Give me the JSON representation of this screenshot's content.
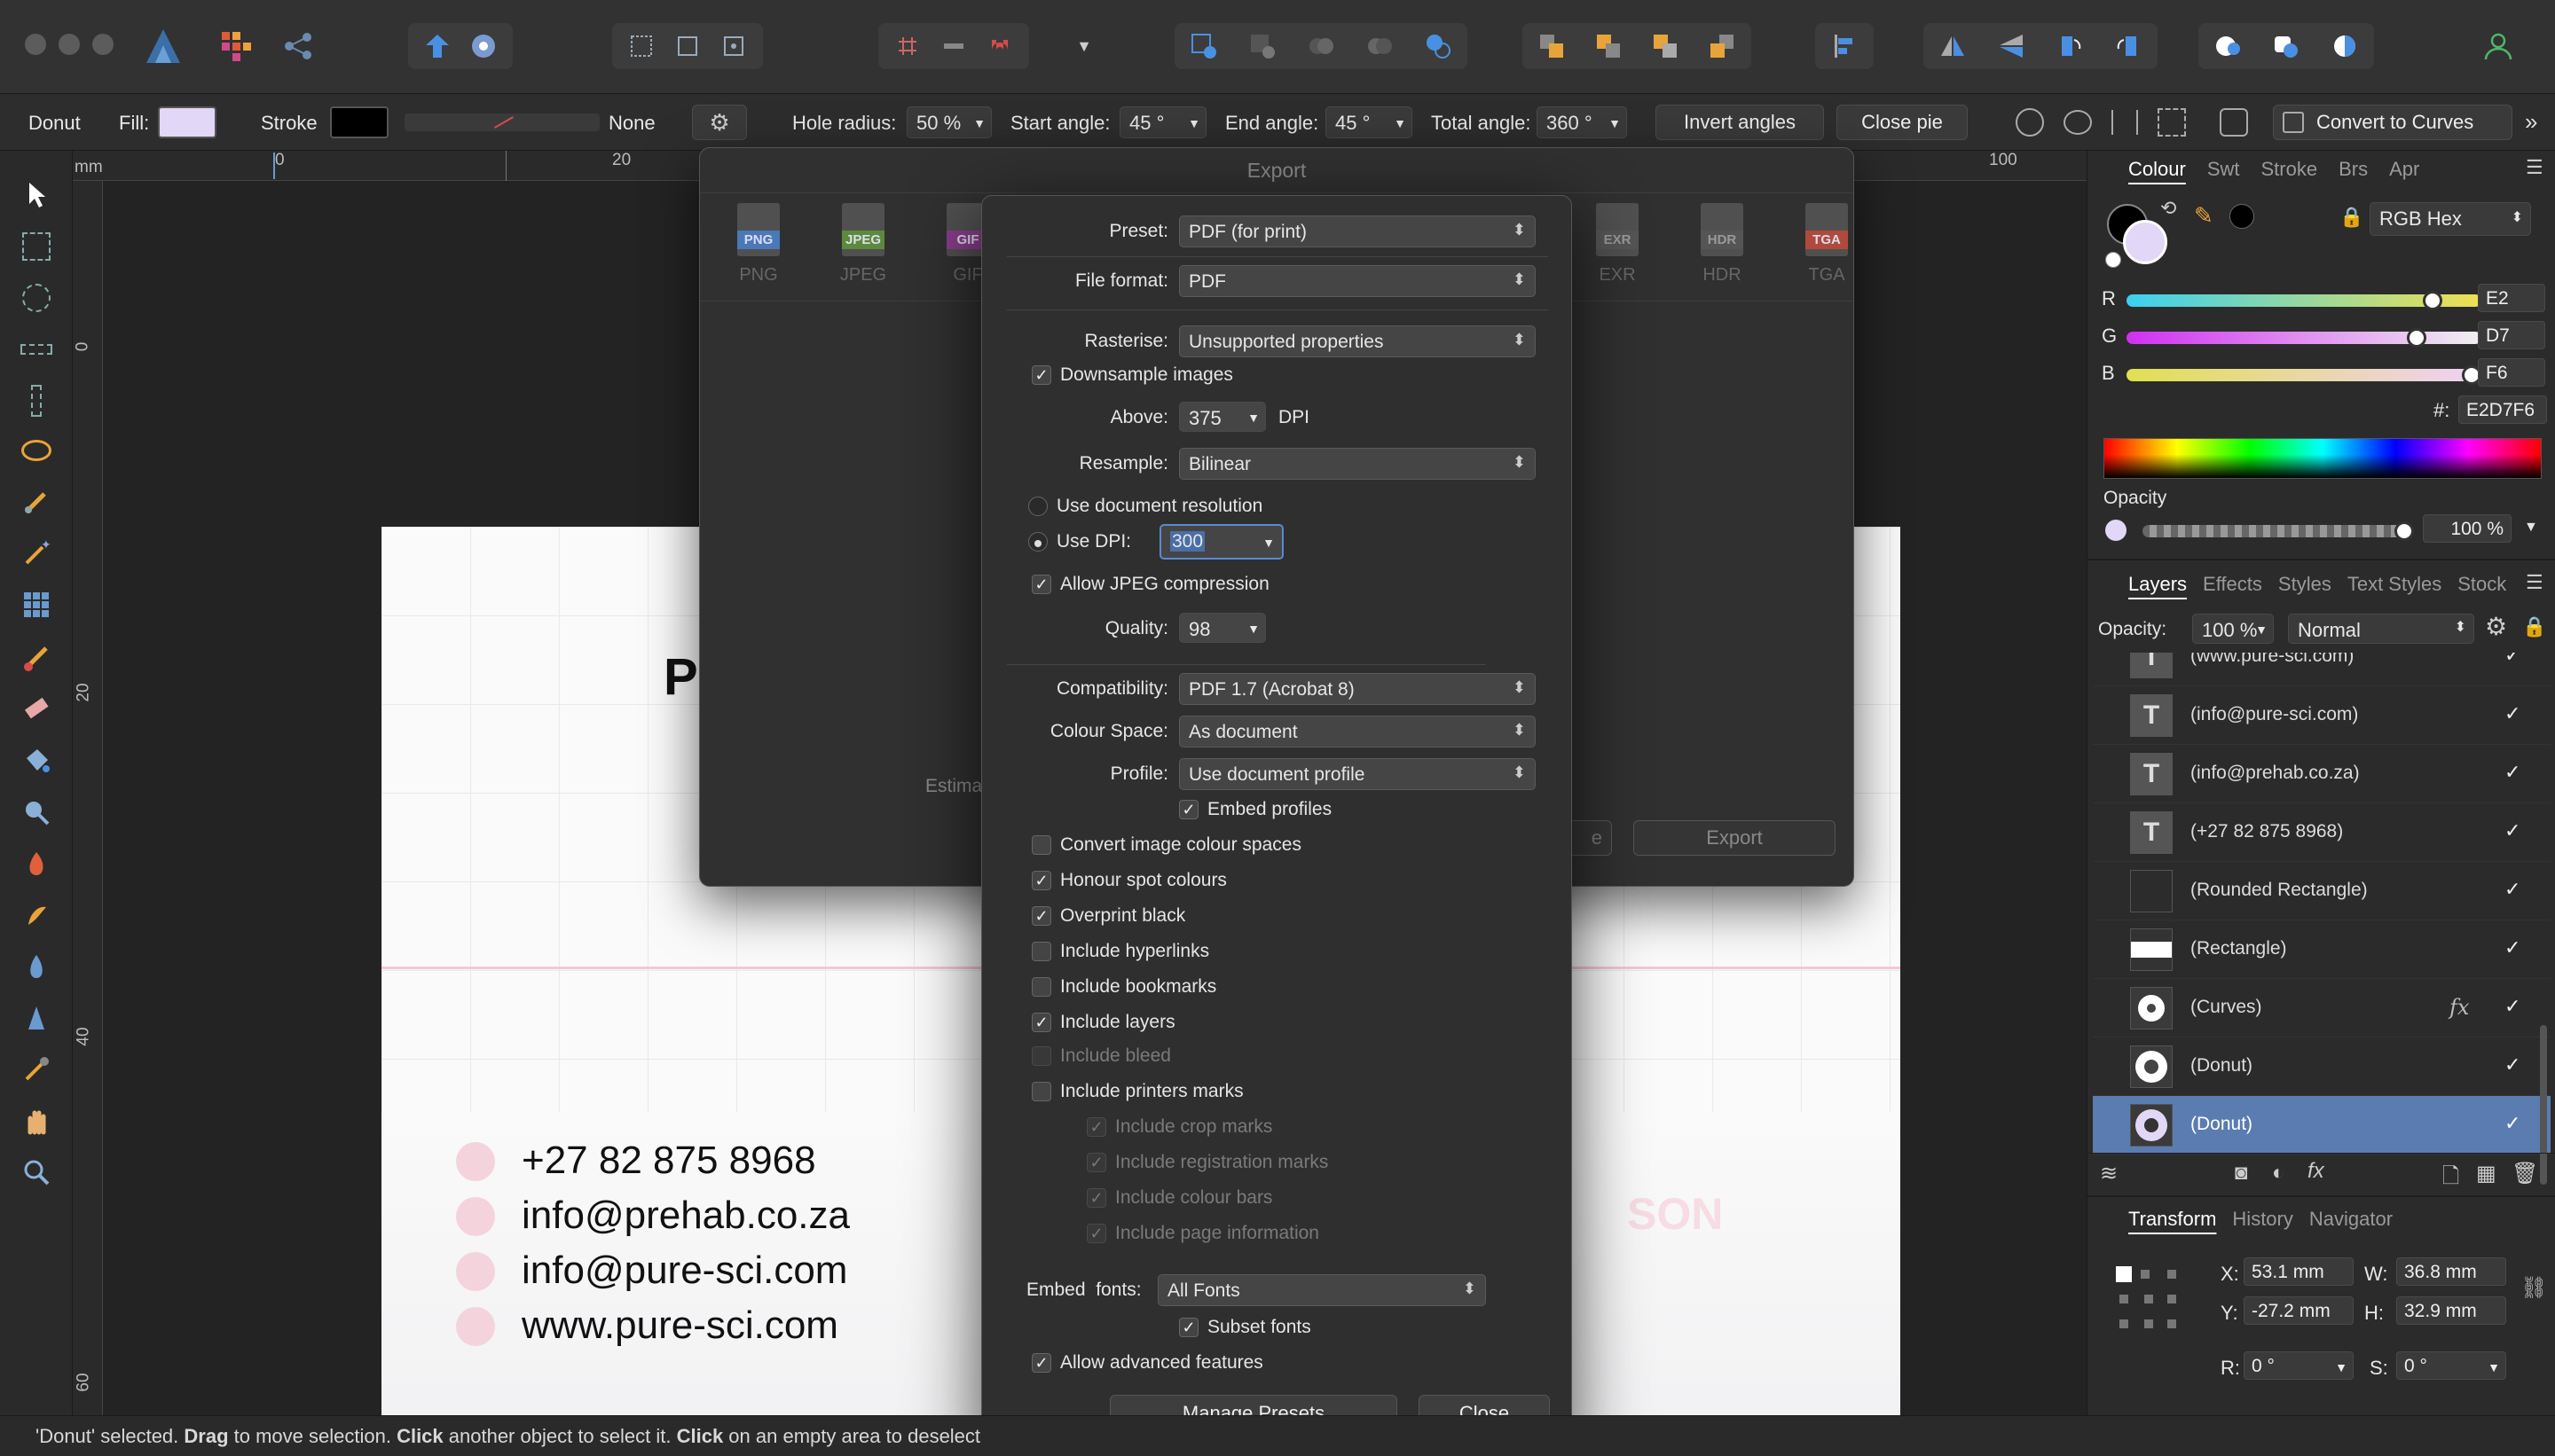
{
  "toolbar": {
    "colors": {
      "accent_blue": "#4a90e2",
      "magnet_red": "#d94a4a"
    }
  },
  "context": {
    "shape_name": "Donut",
    "fill_label": "Fill:",
    "fill_color": "#E2D7F6",
    "stroke_label": "Stroke",
    "stroke_value": "None",
    "hole_radius_label": "Hole radius:",
    "hole_radius_value": "50 %",
    "start_angle_label": "Start angle:",
    "start_angle_value": "45 °",
    "end_angle_label": "End angle:",
    "end_angle_value": "45 °",
    "total_angle_label": "Total angle:",
    "total_angle_value": "360 °",
    "invert_angles": "Invert angles",
    "close_pie": "Close pie",
    "convert_to_curves": "Convert to Curves"
  },
  "ruler": {
    "unit": "mm",
    "h_ticks": [
      "0",
      "20",
      "100"
    ],
    "v_ticks": [
      "0",
      "20",
      "40",
      "60"
    ]
  },
  "document": {
    "brand_partial": "PUR",
    "phone": "+27 82 875 8968",
    "email1": "info@prehab.co.za",
    "email2": "info@pure-sci.com",
    "website": "www.pure-sci.com",
    "faded_text": "SON"
  },
  "export_window": {
    "title": "Export",
    "formats": [
      {
        "tag": "PNG",
        "label": "PNG",
        "color": "#4a78b8"
      },
      {
        "tag": "JPEG",
        "label": "JPEG",
        "color": "#5c8a3c"
      },
      {
        "tag": "GIF",
        "label": "GIF",
        "color": "#8a3c8a"
      },
      {
        "tag": "EXR",
        "label": "EXR",
        "color": "#555555"
      },
      {
        "tag": "HDR",
        "label": "HDR",
        "color": "#555555"
      },
      {
        "tag": "TGA",
        "label": "TGA",
        "color": "#b04a3a"
      }
    ],
    "estimate_partial": "Estima",
    "partial_button": "e",
    "export_button": "Export"
  },
  "sheet": {
    "preset_label": "Preset:",
    "preset_value": "PDF (for print)",
    "file_format_label": "File format:",
    "file_format_value": "PDF",
    "rasterise_label": "Rasterise:",
    "rasterise_value": "Unsupported properties",
    "downsample": "Downsample images",
    "above_label": "Above:",
    "above_value": "375",
    "dpi_unit": "DPI",
    "resample_label": "Resample:",
    "resample_value": "Bilinear",
    "use_doc_res": "Use document resolution",
    "use_dpi_label": "Use DPI:",
    "use_dpi_value": "300",
    "allow_jpeg": "Allow JPEG compression",
    "quality_label": "Quality:",
    "quality_value": "98",
    "compat_label": "Compatibility:",
    "compat_value": "PDF 1.7 (Acrobat 8)",
    "colour_space_label": "Colour Space:",
    "colour_space_value": "As document",
    "profile_label": "Profile:",
    "profile_value": "Use document profile",
    "embed_profiles": "Embed profiles",
    "convert_colour": "Convert image colour spaces",
    "honour_spot": "Honour spot colours",
    "overprint_black": "Overprint black",
    "include_hyperlinks": "Include hyperlinks",
    "include_bookmarks": "Include bookmarks",
    "include_layers": "Include layers",
    "include_bleed": "Include bleed",
    "include_printers_marks": "Include printers marks",
    "crop_marks": "Include crop marks",
    "registration_marks": "Include registration marks",
    "colour_bars": "Include colour bars",
    "page_info": "Include page information",
    "embed_fonts_label": "Embed  fonts:",
    "embed_fonts_value": "All Fonts",
    "subset_fonts": "Subset fonts",
    "allow_advanced": "Allow advanced features",
    "manage_presets": "Manage Presets",
    "close": "Close"
  },
  "colour_panel": {
    "tabs": [
      "Colour",
      "Swt",
      "Stroke",
      "Brs",
      "Apr"
    ],
    "mode": "RGB Hex",
    "r_label": "R",
    "r_value": "E2",
    "r_level": 0.886,
    "g_label": "G",
    "g_value": "D7",
    "g_level": 0.843,
    "b_label": "B",
    "b_value": "F6",
    "b_level": 0.965,
    "hex_label": "#:",
    "hex_value": "E2D7F6",
    "opacity_label": "Opacity",
    "opacity_value": "100 %"
  },
  "layers_panel": {
    "tabs": [
      "Layers",
      "Effects",
      "Styles",
      "Text Styles",
      "Stock"
    ],
    "opacity_label": "Opacity:",
    "opacity_value": "100 %",
    "blend_mode": "Normal",
    "fx": "fx",
    "items": [
      {
        "name": "(www.pure-sci.com)",
        "type": "text"
      },
      {
        "name": "(info@pure-sci.com)",
        "type": "text"
      },
      {
        "name": "(info@prehab.co.za)",
        "type": "text"
      },
      {
        "name": "(+27 82 875 8968)",
        "type": "text"
      },
      {
        "name": "(Rounded Rectangle)",
        "type": "shape"
      },
      {
        "name": "(Rectangle)",
        "type": "rect"
      },
      {
        "name": "(Curves)",
        "type": "curves"
      },
      {
        "name": "(Donut)",
        "type": "donut"
      },
      {
        "name": "(Donut)",
        "type": "donut"
      }
    ]
  },
  "transform_panel": {
    "tabs": [
      "Transform",
      "History",
      "Navigator"
    ],
    "x_label": "X:",
    "x_value": "53.1 mm",
    "y_label": "Y:",
    "y_value": "-27.2 mm",
    "w_label": "W:",
    "w_value": "36.8 mm",
    "h_label": "H:",
    "h_value": "32.9 mm",
    "r_label": "R:",
    "r_value": "0 °",
    "s_label": "S:",
    "s_value": "0 °"
  },
  "status": {
    "p1": "'Donut' selected. ",
    "b1": "Drag",
    "p2": " to move selection. ",
    "b2": "Click",
    "p3": " another object to select it. ",
    "b3": "Click",
    "p4": " on an empty area to deselect"
  }
}
